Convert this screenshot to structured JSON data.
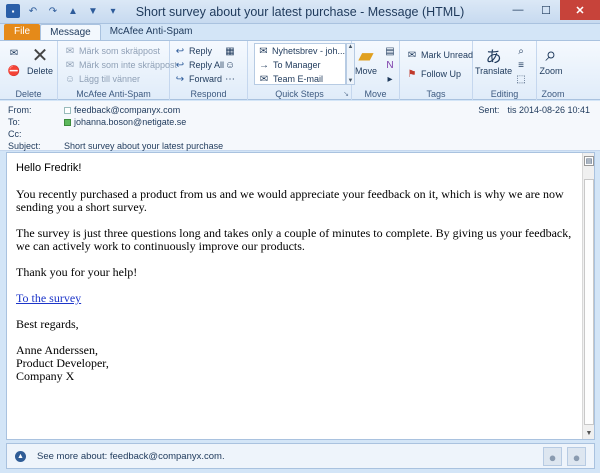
{
  "window": {
    "title": "Short survey about your latest purchase  -  Message (HTML)",
    "controls": {
      "minimize": "—",
      "maximize": "☐",
      "close": "✕"
    }
  },
  "tabs": [
    "File",
    "Message",
    "McAfee Anti-Spam"
  ],
  "ribbon": {
    "delete_group": {
      "label": "Delete",
      "delete_label": "Delete"
    },
    "antispam_group": {
      "label": "McAfee Anti-Spam",
      "items": [
        "Märk som skräppost",
        "Märk som inte skräppost",
        "Lägg till vänner"
      ]
    },
    "respond_group": {
      "label": "Respond",
      "reply": "Reply",
      "reply_all": "Reply All",
      "forward": "Forward"
    },
    "quicksteps_group": {
      "label": "Quick Steps",
      "items": [
        "Nyhetsbrev - joh...",
        "To Manager",
        "Team E-mail"
      ]
    },
    "move_group": {
      "label": "Move",
      "move": "Move"
    },
    "tags_group": {
      "label": "Tags",
      "mark_unread": "Mark Unread",
      "follow_up": "Follow Up"
    },
    "editing_group": {
      "label": "Editing",
      "translate": "Translate"
    },
    "zoom_group": {
      "label": "Zoom",
      "zoom": "Zoom"
    }
  },
  "header": {
    "from_label": "From:",
    "from_value": "feedback@companyx.com",
    "to_label": "To:",
    "to_value": "johanna.boson@netigate.se",
    "cc_label": "Cc:",
    "subject_label": "Subject:",
    "subject_value": "Short survey about your latest purchase",
    "sent_label": "Sent:",
    "sent_value": "tis 2014-08-26 10:41"
  },
  "body": {
    "greeting": "Hello Fredrik!",
    "p1": "You recently purchased a product from us and we would appreciate your feedback on it, which is why we are now sending you a short survey.",
    "p2": "The survey is just three questions long and takes only a couple of minutes to complete. By giving us your feedback, we can actively work to continuously improve our products.",
    "p3": "Thank you for your help!",
    "link": "To the survey",
    "closing": "Best regards,",
    "sig_name": "Anne Anderssen,",
    "sig_title": "Product Developer,",
    "sig_company": "Company X"
  },
  "people_pane": {
    "text": "See more about: feedback@companyx.com."
  },
  "colors": {
    "file_tab": "#e58a19",
    "close_button": "#c7433a",
    "link": "#1c35c9"
  }
}
